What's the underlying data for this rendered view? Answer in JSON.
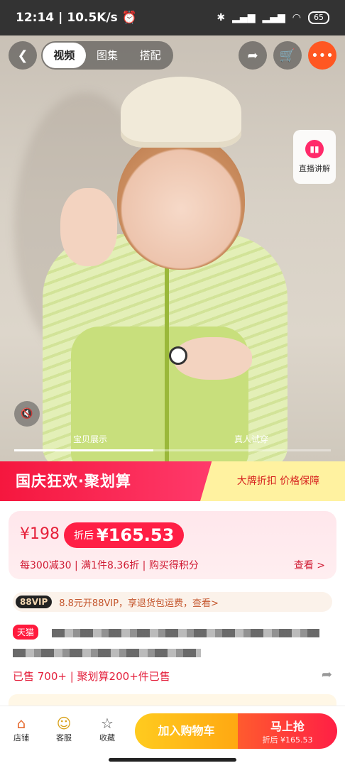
{
  "status_bar": {
    "time": "12:14",
    "speed": "10.5K/s",
    "alarm_icon": "alarm-icon",
    "battery": "65"
  },
  "nav": {
    "tabs": [
      {
        "label": "视频",
        "active": true
      },
      {
        "label": "图集",
        "active": false
      },
      {
        "label": "搭配",
        "active": false
      }
    ]
  },
  "media": {
    "live_label": "直播讲解",
    "labels": [
      "宝贝展示",
      "真人试穿"
    ],
    "progress": 0.44
  },
  "promo": {
    "left": "国庆狂欢·聚划算",
    "right": "大牌折扣 价格保障"
  },
  "price": {
    "original": "¥198",
    "discount_label": "折后",
    "discount_price": "¥165.53",
    "promos": "每300减30 | 满1件8.36折 | 购买得积分",
    "view": "查看 >"
  },
  "vip": {
    "badge": "88VIP",
    "text": "8.8元开88VIP，享退货包运费，查看>"
  },
  "title": {
    "store_badge": "天猫"
  },
  "sold": {
    "text": "已售 700+ | 聚划算200+件已售"
  },
  "bottom": {
    "store": "店铺",
    "service": "客服",
    "favorite": "收藏",
    "add_cart": "加入购物车",
    "buy_title": "马上抢",
    "buy_sub": "折后 ¥165.53"
  },
  "colors": {
    "accent": "#ff1f45",
    "cart": "#ffb514",
    "promo": "#f5173e"
  }
}
